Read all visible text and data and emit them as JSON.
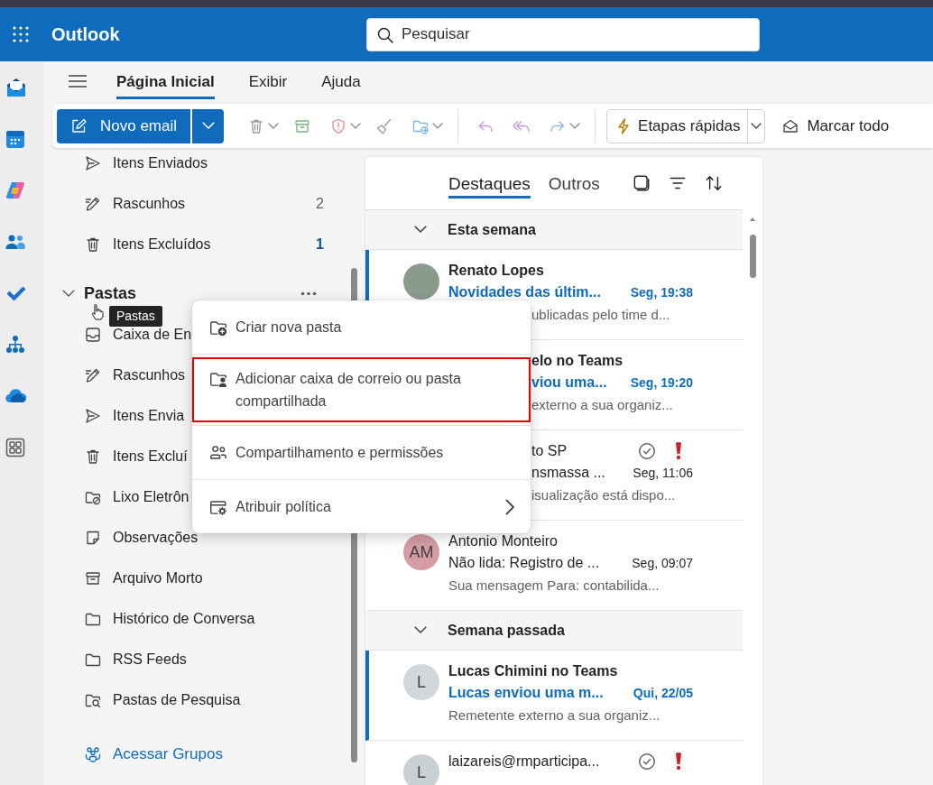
{
  "header": {
    "app_name": "Outlook",
    "search": {
      "placeholder": "Pesquisar"
    }
  },
  "rail": [
    {
      "kind": "mail"
    },
    {
      "kind": "calendar"
    },
    {
      "kind": "copilot"
    },
    {
      "kind": "people"
    },
    {
      "kind": "todo"
    },
    {
      "kind": "org"
    },
    {
      "kind": "cloud"
    },
    {
      "kind": "apps"
    }
  ],
  "ribbon": {
    "tabs": [
      {
        "label": "Página Inicial",
        "selected": true
      },
      {
        "label": "Exibir",
        "selected": false
      },
      {
        "label": "Ajuda",
        "selected": false
      }
    ],
    "toolbar": [
      {
        "kind": "new",
        "label": "Novo email",
        "disabled": false,
        "dropdown": true
      },
      {
        "kind": "delete",
        "disabled": true,
        "dropdown": true
      },
      {
        "kind": "archive",
        "disabled": true,
        "dropdown": false
      },
      {
        "kind": "report",
        "disabled": true,
        "dropdown": true
      },
      {
        "kind": "sweep",
        "disabled": true,
        "dropdown": false
      },
      {
        "kind": "move",
        "disabled": true,
        "dropdown": true
      },
      {
        "kind": "separator"
      },
      {
        "kind": "reply",
        "disabled": true,
        "dropdown": false
      },
      {
        "kind": "replyall",
        "disabled": true,
        "dropdown": false
      },
      {
        "kind": "forward",
        "disabled": true,
        "dropdown": true
      },
      {
        "kind": "separator"
      },
      {
        "kind": "quicksteps",
        "label": "Etapas rápidas",
        "disabled": false,
        "dropdown": true
      },
      {
        "kind": "markread",
        "label": "Marcar todo",
        "disabled": false,
        "dropdown": false
      }
    ]
  },
  "folders": {
    "favorites": [
      {
        "kind": "sent",
        "label": "Itens Enviados",
        "unread": false
      },
      {
        "kind": "drafts",
        "label": "Rascunhos",
        "count": "2",
        "unread": false
      },
      {
        "kind": "deleted",
        "label": "Itens Excluídos",
        "count": "1",
        "unread": true
      }
    ],
    "section": {
      "title": "Pastas",
      "expanded": true,
      "tooltip": "Pastas"
    },
    "items": [
      {
        "kind": "inbox",
        "label": "Caixa de En",
        "unread": false
      },
      {
        "kind": "drafts",
        "label": "Rascunhos",
        "unread": false
      },
      {
        "kind": "sent",
        "label": "Itens Envia",
        "unread": false
      },
      {
        "kind": "deleted",
        "label": "Itens Excluí",
        "unread": false
      },
      {
        "kind": "junk",
        "label": "Lixo Eletrôn",
        "unread": false
      },
      {
        "kind": "notes",
        "label": "Observações",
        "unread": false
      },
      {
        "kind": "archive",
        "label": "Arquivo Morto",
        "unread": false
      },
      {
        "kind": "folder",
        "label": "Histórico de Conversa",
        "unread": false
      },
      {
        "kind": "folder",
        "label": "RSS Feeds",
        "unread": false
      },
      {
        "kind": "search",
        "label": "Pastas de Pesquisa",
        "unread": false
      }
    ],
    "groups_link": "Acessar Grupos"
  },
  "context_menu": {
    "items": [
      {
        "kind": "newfolder",
        "label": "Criar nova pasta",
        "highlighted": false,
        "submenu": false
      },
      {
        "kind": "shared",
        "label": "Adicionar caixa de correio ou pasta compartilhada",
        "highlighted": true,
        "submenu": false
      },
      {
        "kind": "permissions",
        "label": "Compartilhamento e permissões",
        "highlighted": false,
        "submenu": false
      },
      {
        "kind": "policy",
        "label": "Atribuir política",
        "highlighted": false,
        "submenu": true
      }
    ]
  },
  "mail_list": {
    "tabs": [
      {
        "label": "Destaques",
        "selected": true
      },
      {
        "label": "Outros",
        "selected": false
      }
    ],
    "groups": [
      {
        "title": "Esta semana",
        "expanded": true,
        "messages": [
          {
            "sender": "Renato Lopes",
            "subject": "Novidades das últim...",
            "time": "Seg, 19:38",
            "preview": "ublicadas pelo time d...",
            "avatar": {
              "kind": "photo"
            },
            "unread": true,
            "tracked": false,
            "important": false
          },
          {
            "sender": "elo no Teams",
            "subject": "viou uma...",
            "time": "Seg, 19:20",
            "preview": "externo a sua organiz...",
            "unread": true,
            "tracked": false,
            "important": false
          },
          {
            "sender": "to SP",
            "subject": "nsmassa ...",
            "time": "Seg, 11:06",
            "preview": "isualização está dispo...",
            "unread": false,
            "tracked": true,
            "important": true
          },
          {
            "sender": "Antonio Monteiro",
            "subject": "Não lida: Registro de ...",
            "time": "Seg, 09:07",
            "preview": "Sua mensagem Para: contabilida...",
            "avatar": {
              "kind": "initials",
              "initials": "AM",
              "color": "#d69ca5"
            },
            "unread": false,
            "tracked": false,
            "important": false
          }
        ]
      },
      {
        "title": "Semana passada",
        "expanded": true,
        "messages": [
          {
            "sender": "Lucas Chimini no Teams",
            "subject": "Lucas enviou uma m...",
            "time": "Qui, 22/05",
            "preview": "Remetente externo a sua organiz...",
            "avatar": {
              "kind": "initials",
              "initials": "L",
              "color": "#d1d8dc"
            },
            "unread": true,
            "tracked": false,
            "important": false
          },
          {
            "sender": "laizareis@rmparticipa...",
            "avatar": {
              "kind": "initials",
              "initials": "L",
              "color": "#c8d0d4"
            },
            "unread": false,
            "tracked": true,
            "important": true
          }
        ]
      }
    ]
  }
}
